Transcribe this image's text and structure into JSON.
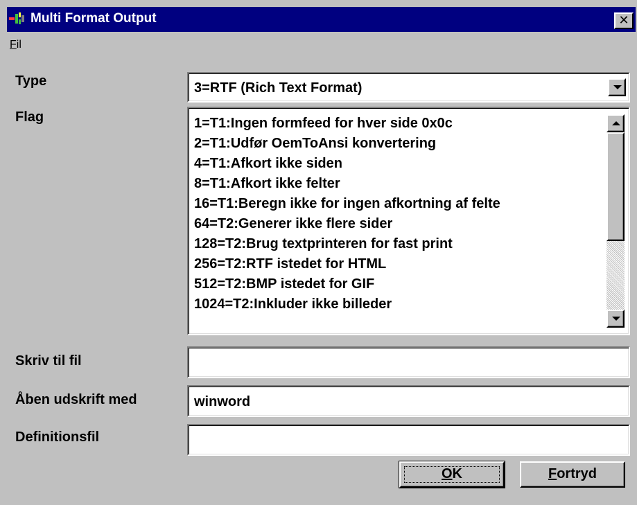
{
  "window": {
    "title": "Multi Format Output",
    "close_glyph": "✕",
    "title_color": "#000080",
    "face_color": "#c0c0c0"
  },
  "menu": {
    "items": [
      {
        "label": "Fil",
        "accelerator": "F"
      }
    ]
  },
  "form": {
    "type": {
      "label": "Type",
      "selected": "3=RTF (Rich Text Format)"
    },
    "flag": {
      "label": "Flag",
      "items": [
        "1=T1:Ingen formfeed for hver side 0x0c",
        "2=T1:Udfør OemToAnsi konvertering",
        "4=T1:Afkort ikke siden",
        "8=T1:Afkort ikke felter",
        "16=T1:Beregn ikke for ingen afkortning af felte",
        "64=T2:Generer ikke flere sider",
        "128=T2:Brug textprinteren for fast print",
        "256=T2:RTF istedet for HTML",
        "512=T2:BMP istedet for GIF",
        "1024=T2:Inkluder ikke billeder"
      ]
    },
    "skriv_til_fil": {
      "label": "Skriv til fil",
      "value": ""
    },
    "aaben_udskrift_med": {
      "label": "Åben udskrift med",
      "value": "winword"
    },
    "definitionsfil": {
      "label": "Definitionsfil",
      "value": ""
    }
  },
  "buttons": {
    "ok": {
      "label_acc": "O",
      "label_rest": "K"
    },
    "cancel": {
      "label_acc": "F",
      "label_rest": "ortryd"
    }
  }
}
